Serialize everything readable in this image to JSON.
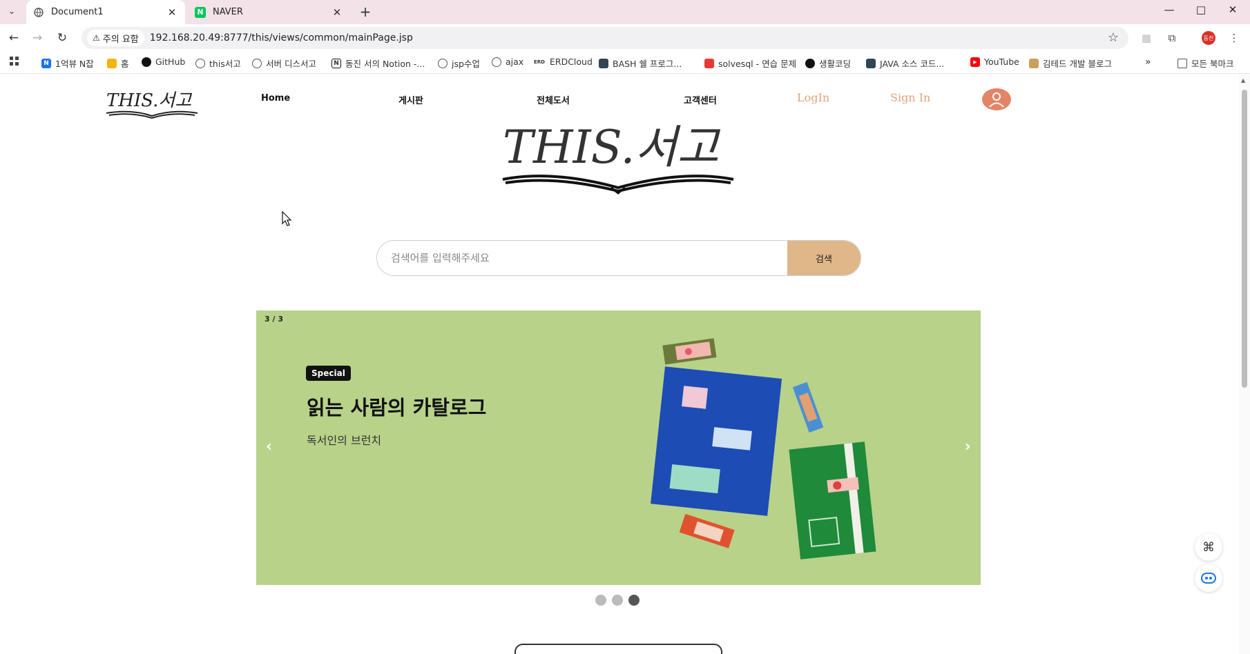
{
  "browser": {
    "tabs": [
      {
        "title": "Document1",
        "active": true
      },
      {
        "title": "NAVER",
        "active": false
      }
    ],
    "security_label": "주의 요함",
    "url": "192.168.20.49:8777/this/views/common/mainPage.jsp",
    "profile_initials": "동진",
    "bookmarks": [
      {
        "label": "1억뷰 N잡",
        "icon": "naver-n-icon"
      },
      {
        "label": "홈",
        "icon": "google-classroom-icon"
      },
      {
        "label": "GitHub",
        "icon": "github-icon"
      },
      {
        "label": "this서고",
        "icon": "globe-icon"
      },
      {
        "label": "서버 디스서고",
        "icon": "globe-icon"
      },
      {
        "label": "동진 서의 Notion -...",
        "icon": "notion-icon"
      },
      {
        "label": "jsp수업",
        "icon": "globe-icon"
      },
      {
        "label": "ajax",
        "icon": "globe-icon"
      },
      {
        "label": "ERDCloud",
        "icon": "erd-icon"
      },
      {
        "label": "BASH 쉘 프로그...",
        "icon": "bash-icon"
      },
      {
        "label": "solvesql - 연습 문제",
        "icon": "solvesql-icon"
      },
      {
        "label": "생활코딩",
        "icon": "dot-icon"
      },
      {
        "label": "JAVA 소스 코드...",
        "icon": "java-icon"
      },
      {
        "label": "YouTube",
        "icon": "youtube-icon"
      },
      {
        "label": "김테드 개발 블로그",
        "icon": "blog-icon"
      }
    ],
    "all_bookmarks_label": "모든 북마크"
  },
  "site": {
    "logo_text": "THIS.서고",
    "nav": [
      "Home",
      "게시판",
      "전체도서",
      "고객센터"
    ],
    "login_label": "LogIn",
    "signin_label": "Sign In",
    "search": {
      "placeholder": "검색어를 입력해주세요",
      "button_label": "검색"
    },
    "banner": {
      "counter": "3 / 3",
      "badge": "Special",
      "title": "읽는 사람의 카탈로그",
      "subtitle": "독서인의 브런치",
      "active_slide": 3,
      "slide_count": 3
    }
  },
  "colors": {
    "banner_bg": "#b8d28a",
    "search_button": "#dfb788",
    "auth_text": "#e0a47a",
    "avatar": "#e48466"
  }
}
